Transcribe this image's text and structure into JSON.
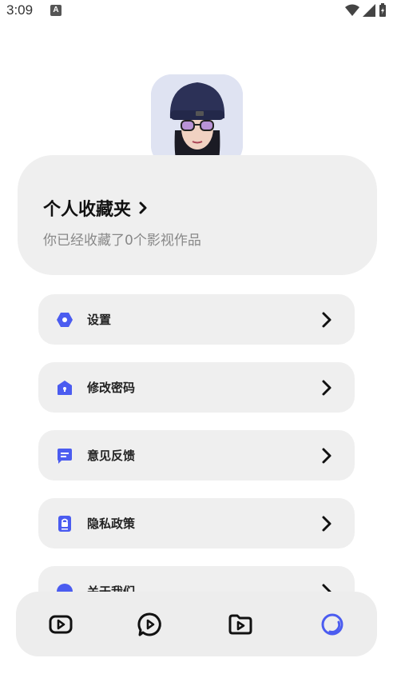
{
  "status_bar": {
    "time": "3:09",
    "notification_badge": "A"
  },
  "favorites": {
    "title": "个人收藏夹",
    "subtitle": "你已经收藏了0个影视作品"
  },
  "menu": {
    "items": [
      {
        "label": "设置",
        "icon": "settings-hexagon-icon"
      },
      {
        "label": "修改密码",
        "icon": "lock-icon"
      },
      {
        "label": "意见反馈",
        "icon": "feedback-icon"
      },
      {
        "label": "隐私政策",
        "icon": "privacy-icon"
      },
      {
        "label": "关于我们",
        "icon": "about-icon"
      }
    ]
  },
  "bottom_nav": {
    "items": [
      {
        "icon": "video-play-icon",
        "active": false
      },
      {
        "icon": "chat-play-icon",
        "active": false
      },
      {
        "icon": "folder-play-icon",
        "active": false
      },
      {
        "icon": "profile-ring-icon",
        "active": true
      }
    ]
  },
  "colors": {
    "accent": "#4b5cf0",
    "card": "#efefef",
    "text": "#111111",
    "muted": "#888888"
  }
}
